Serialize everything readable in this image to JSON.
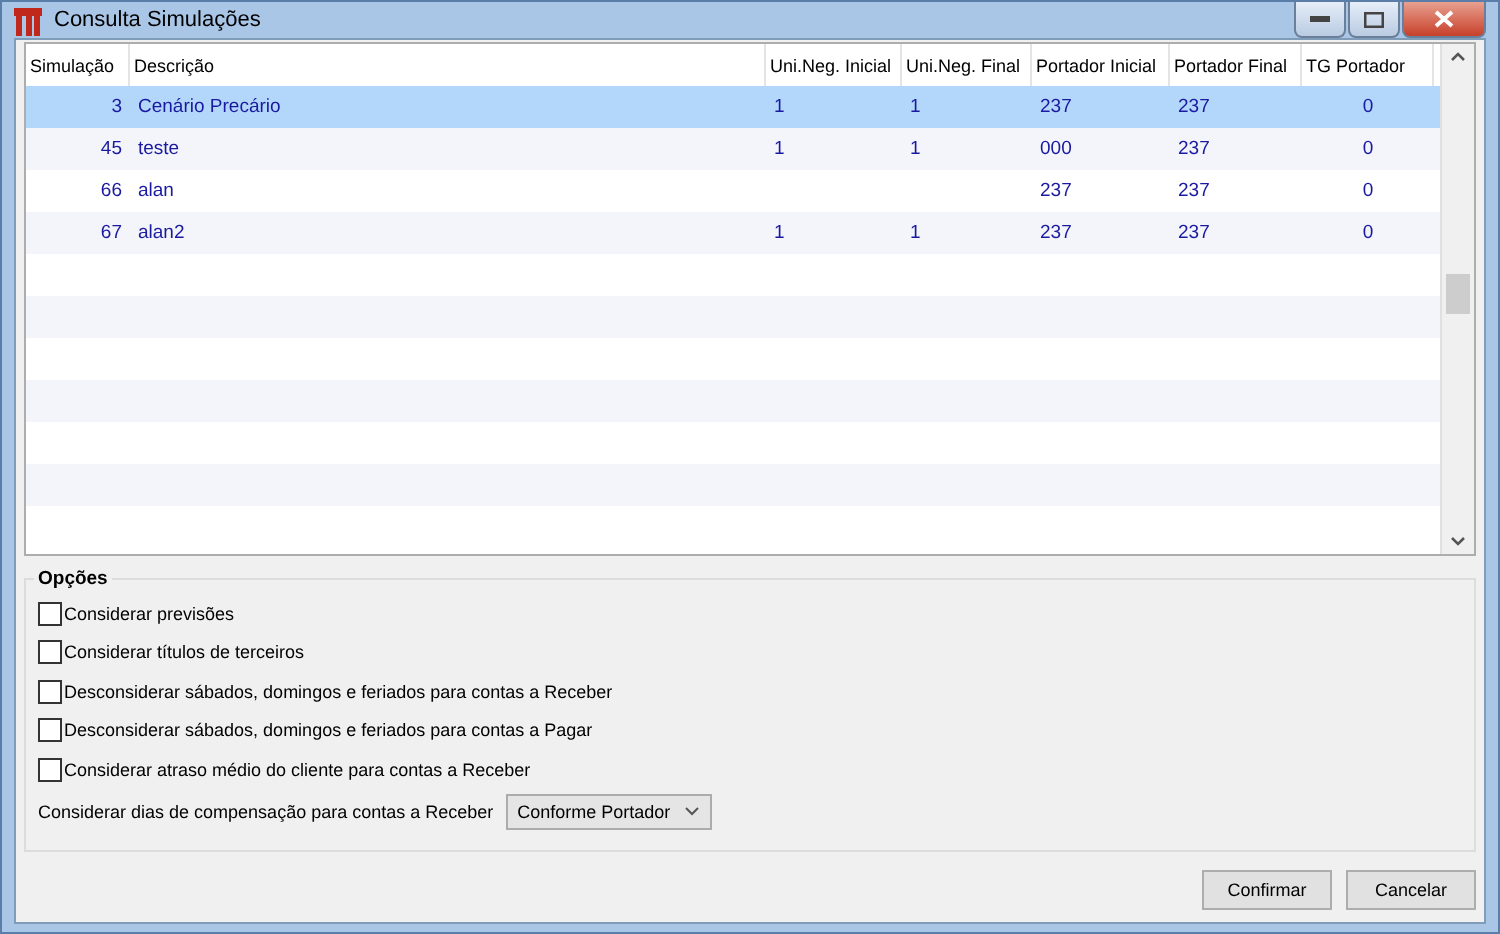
{
  "window": {
    "title": "Consulta Simulações"
  },
  "table": {
    "columns": [
      "Simulação",
      "Descrição",
      "Uni.Neg. Inicial",
      "Uni.Neg. Final",
      "Portador Inicial",
      "Portador Final",
      "TG Portador"
    ],
    "rows": [
      {
        "selected": true,
        "cells": [
          "3",
          "Cenário Precário",
          "1",
          "1",
          "237",
          "237",
          "0"
        ]
      },
      {
        "selected": false,
        "cells": [
          "45",
          "teste",
          "1",
          "1",
          "000",
          "237",
          "0"
        ]
      },
      {
        "selected": false,
        "cells": [
          "66",
          "alan",
          "",
          "",
          "237",
          "237",
          "0"
        ]
      },
      {
        "selected": false,
        "cells": [
          "67",
          "alan2",
          "1",
          "1",
          "237",
          "237",
          "0"
        ]
      }
    ]
  },
  "options": {
    "title": "Opções",
    "checkboxes": [
      {
        "label": "Considerar previsões",
        "checked": false
      },
      {
        "label": "Considerar títulos de terceiros",
        "checked": false
      },
      {
        "label": "Desconsiderar sábados, domingos e feriados para contas a Receber",
        "checked": false
      },
      {
        "label": "Desconsiderar sábados, domingos e feriados para contas a Pagar",
        "checked": false
      },
      {
        "label": "Considerar atraso médio do cliente para contas a Receber",
        "checked": false
      }
    ],
    "compensation": {
      "label": "Considerar dias de compensação para contas a Receber",
      "value": "Conforme Portador"
    }
  },
  "buttons": [
    "Confirmar",
    "Cancelar"
  ]
}
